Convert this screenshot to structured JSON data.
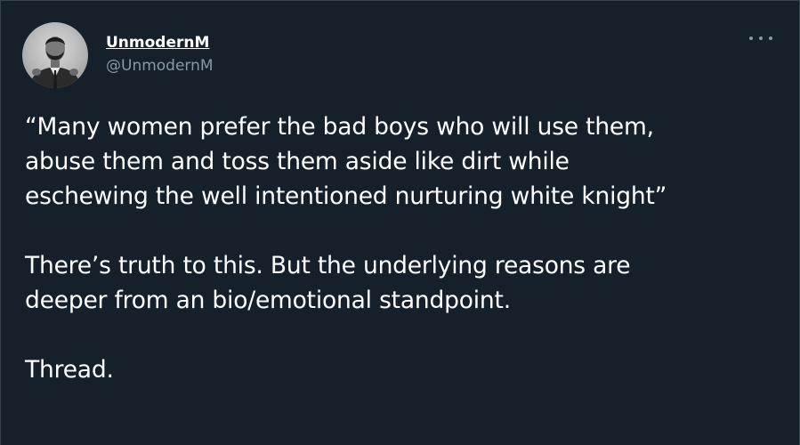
{
  "tweet": {
    "author": {
      "display_name": "UnmodernM",
      "handle": "@UnmodernM",
      "avatar_icon": "profile-photo"
    },
    "more_icon": "more-options-icon",
    "paragraphs": [
      "“Many women prefer the bad boys who will use them,\nabuse them and toss them aside like dirt while\neschewing the well intentioned nurturing white knight”",
      "There’s truth to this. But the underlying reasons are\ndeeper from an bio/emotional standpoint.",
      "Thread."
    ]
  },
  "colors": {
    "background": "#15202b",
    "text": "#ffffff",
    "secondary": "#8899a6",
    "border": "#38444d"
  }
}
